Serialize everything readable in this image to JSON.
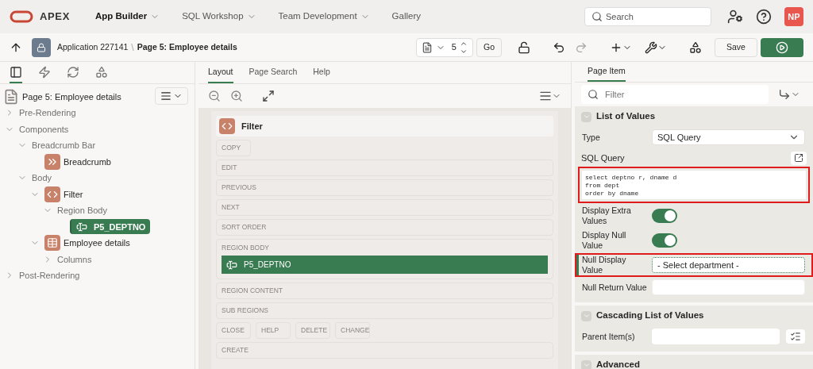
{
  "header": {
    "logo_text": "APEX",
    "nav": [
      {
        "label": "App Builder",
        "selected": true,
        "menu": true
      },
      {
        "label": "SQL Workshop",
        "selected": false,
        "menu": true
      },
      {
        "label": "Team Development",
        "selected": false,
        "menu": true
      },
      {
        "label": "Gallery",
        "selected": false,
        "menu": false
      }
    ],
    "search": {
      "placeholder": "Search"
    },
    "avatar": "NP"
  },
  "toolbar": {
    "application": "Application 227141",
    "separator": "\\",
    "page": "Page 5: Employee details",
    "page_number": "5",
    "go": "Go",
    "save": "Save"
  },
  "left": {
    "tabs": [
      {
        "kind": "rendering",
        "selected": true
      },
      {
        "kind": "dynamic",
        "selected": false
      },
      {
        "kind": "processing",
        "selected": false
      },
      {
        "kind": "shared",
        "selected": false
      }
    ],
    "tree": {
      "label": "Page 5: Employee details",
      "kind": "page",
      "children": [
        {
          "label": "Pre-Rendering",
          "kind": "group",
          "expanded": false
        },
        {
          "label": "Components",
          "kind": "group",
          "expanded": true,
          "children": [
            {
              "label": "Breadcrumb Bar",
              "kind": "group",
              "expanded": true,
              "children": [
                {
                  "label": "Breadcrumb",
                  "kind": "breadcrumb",
                  "selected": false
                }
              ]
            },
            {
              "label": "Body",
              "kind": "group",
              "expanded": true,
              "children": [
                {
                  "label": "Filter",
                  "kind": "region",
                  "expanded": true,
                  "selected": false,
                  "children": [
                    {
                      "label": "Region Body",
                      "kind": "group",
                      "expanded": true,
                      "children": [
                        {
                          "label": "P5_DEPTNO",
                          "kind": "item",
                          "selected": true
                        }
                      ]
                    }
                  ]
                },
                {
                  "label": "Employee details",
                  "kind": "table",
                  "expanded": true,
                  "selected": false,
                  "children": [
                    {
                      "label": "Columns",
                      "kind": "group",
                      "expanded": false
                    }
                  ]
                }
              ]
            }
          ]
        },
        {
          "label": "Post-Rendering",
          "kind": "group",
          "expanded": false
        }
      ]
    }
  },
  "center": {
    "tabs": [
      {
        "label": "Layout",
        "selected": true
      },
      {
        "label": "Page Search",
        "selected": false
      },
      {
        "label": "Help",
        "selected": false
      }
    ],
    "region": {
      "title": "Filter",
      "rows": [
        {
          "kind": "buttons",
          "slots": [
            "COPY"
          ]
        },
        {
          "kind": "bar",
          "label": "EDIT"
        },
        {
          "kind": "bar",
          "label": "PREVIOUS"
        },
        {
          "kind": "bar",
          "label": "NEXT"
        },
        {
          "kind": "bar",
          "label": "SORT ORDER"
        },
        {
          "kind": "bar",
          "label": "REGION BODY",
          "items": [
            {
              "label": "P5_DEPTNO",
              "selected": true
            }
          ]
        },
        {
          "kind": "bar",
          "label": "REGION CONTENT"
        },
        {
          "kind": "bar",
          "label": "SUB REGIONS"
        },
        {
          "kind": "buttons",
          "slots": [
            "CLOSE",
            "HELP",
            "DELETE",
            "CHANGE"
          ]
        },
        {
          "kind": "bar",
          "label": "CREATE"
        }
      ]
    }
  },
  "right": {
    "tab": "Page Item",
    "filter": {
      "placeholder": "Filter"
    },
    "sections": [
      {
        "title": "List of Values",
        "expanded": true,
        "properties": [
          {
            "kind": "select",
            "label": "Type",
            "value": "SQL Query"
          },
          {
            "kind": "code",
            "label": "SQL Query",
            "value": "select deptno r, dname d\nfrom dept\norder by dname",
            "highlighted": true
          },
          {
            "kind": "switch",
            "label": "Display Extra Values",
            "on": true
          },
          {
            "kind": "switch",
            "label": "Display Null Value",
            "on": true
          },
          {
            "kind": "text",
            "label": "Null Display Value",
            "value": "- Select department -",
            "highlighted": true,
            "focused": true
          },
          {
            "kind": "text",
            "label": "Null Return Value"
          }
        ]
      },
      {
        "title": "Cascading List of Values",
        "expanded": true,
        "properties": [
          {
            "kind": "picker",
            "label": "Parent Item(s)"
          }
        ]
      },
      {
        "title": "Advanced",
        "expanded": true
      }
    ]
  }
}
